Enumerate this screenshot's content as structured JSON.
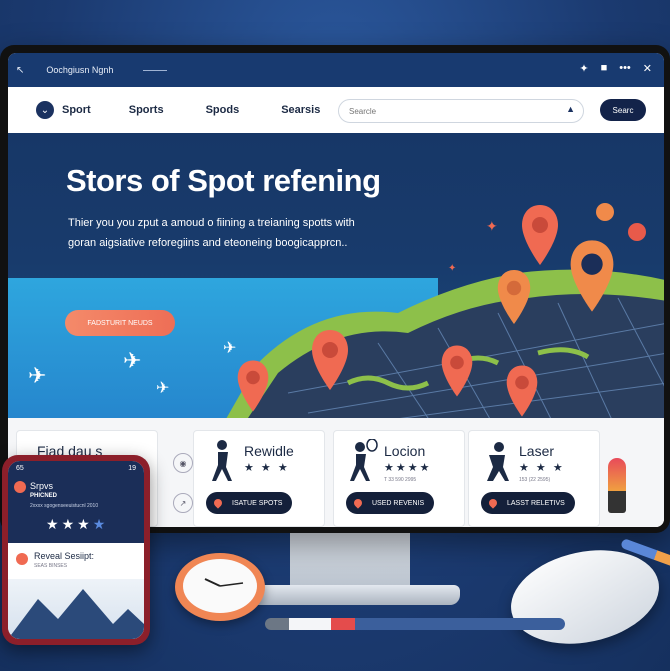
{
  "window": {
    "title": "Oochgiusn Ngnh",
    "controls": [
      "pin-icon",
      "square-icon",
      "more-icon",
      "close-icon"
    ]
  },
  "nav": {
    "items": [
      "Sport",
      "Sports",
      "Spods",
      "Searsis"
    ],
    "search_placeholder": "Searcle",
    "search_button": "Searc"
  },
  "hero": {
    "title": "Stors of Spot refening",
    "subtitle_line1": "Thier you you zput a amoud o fiining a treianing spotts with",
    "subtitle_line2": "goran aigsiative reforegiins and eteoneing boogicapprcn..",
    "cta": "FADSTURIT NEUDS"
  },
  "cards": {
    "left_title": "Fiad dau s",
    "items": [
      {
        "title": "Rewidle",
        "stars": "★ ★ ★",
        "pill": "ISATUE SPOTS"
      },
      {
        "title": "Locion",
        "stars": "★★★★",
        "sub": "T 33 590 2995",
        "pill": "USED REVENIS"
      },
      {
        "title": "Laser",
        "stars": "★ ★ ★",
        "sub": "153 (22 2595)",
        "pill": "LASST RELETIVS"
      }
    ]
  },
  "phone": {
    "status_left": "65",
    "status_right": "19",
    "app_title": "Srpvs",
    "app_subtitle": "PHICNED",
    "app_detail": "2xxxx sgogenseeuistucnl 2010",
    "rating_stars": 4,
    "row_title": "Reveal Sesiipt:",
    "row_sub": "SEAS BINSES"
  },
  "colors": {
    "nav_dark": "#183a70",
    "accent_coral": "#f06a52",
    "sea_blue": "#2ea6de",
    "land_green": "#8dc04a"
  }
}
